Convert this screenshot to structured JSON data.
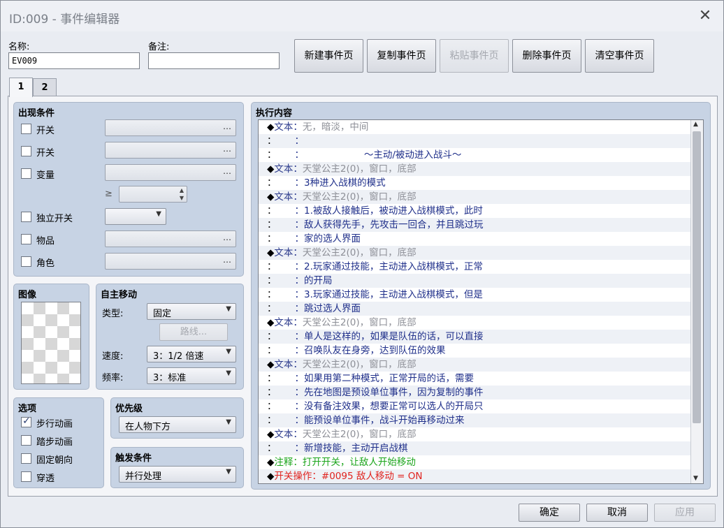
{
  "window": {
    "title": "ID:009 - 事件编辑器",
    "close_icon": "close-icon"
  },
  "fields": {
    "name_label": "名称:",
    "name_value": "EV009",
    "note_label": "备注:",
    "note_value": ""
  },
  "toolbar": {
    "new_page": "新建事件页",
    "copy_page": "复制事件页",
    "paste_page": "粘贴事件页",
    "delete_page": "删除事件页",
    "clear_page": "清空事件页"
  },
  "tabs": [
    "1",
    "2"
  ],
  "conditions": {
    "title": "出现条件",
    "switch1": "开关",
    "switch2": "开关",
    "variable": "变量",
    "gte": "≥",
    "self_switch": "独立开关",
    "item": "物品",
    "actor": "角色",
    "dots": "…"
  },
  "image": {
    "title": "图像"
  },
  "autonomous": {
    "title": "自主移动",
    "type_label": "类型:",
    "type_value": "固定",
    "route_button": "路线...",
    "speed_label": "速度:",
    "speed_value": "3：1/2 倍速",
    "freq_label": "频率:",
    "freq_value": "3：标准"
  },
  "options": {
    "title": "选项",
    "walking": "步行动画",
    "stepping": "踏步动画",
    "direction_fix": "固定朝向",
    "through": "穿透"
  },
  "priority": {
    "title": "优先级",
    "value": "在人物下方"
  },
  "trigger": {
    "title": "触发条件",
    "value": "并行处理"
  },
  "contents": {
    "title": "执行内容",
    "rows": [
      {
        "prefix": "◆",
        "cmd": "文本",
        "sep": "：",
        "text": "无，暗淡，中间",
        "style": "gray"
      },
      {
        "prefix": "：",
        "cmd": "",
        "sep": "：",
        "text": "",
        "style": "body"
      },
      {
        "prefix": "：",
        "cmd": "",
        "sep": "：",
        "text": "                    ～主动/被动进入战斗～",
        "style": "body"
      },
      {
        "prefix": "◆",
        "cmd": "文本",
        "sep": "：",
        "text": "天堂公主2(0)，窗口，底部",
        "style": "gray"
      },
      {
        "prefix": "：",
        "cmd": "",
        "sep": "：",
        "text": "3种进入战棋的模式",
        "style": "body"
      },
      {
        "prefix": "◆",
        "cmd": "文本",
        "sep": "：",
        "text": "天堂公主2(0)，窗口，底部",
        "style": "gray"
      },
      {
        "prefix": "：",
        "cmd": "",
        "sep": "：",
        "text": "1.被敌人接触后，被动进入战棋模式，此时",
        "style": "body"
      },
      {
        "prefix": "：",
        "cmd": "",
        "sep": "：",
        "text": "敌人获得先手，先攻击一回合，并且跳过玩",
        "style": "body"
      },
      {
        "prefix": "：",
        "cmd": "",
        "sep": "：",
        "text": "家的选人界面",
        "style": "body"
      },
      {
        "prefix": "◆",
        "cmd": "文本",
        "sep": "：",
        "text": "天堂公主2(0)，窗口，底部",
        "style": "gray"
      },
      {
        "prefix": "：",
        "cmd": "",
        "sep": "：",
        "text": "2.玩家通过技能，主动进入战棋模式，正常",
        "style": "body"
      },
      {
        "prefix": "：",
        "cmd": "",
        "sep": "：",
        "text": "的开局",
        "style": "body"
      },
      {
        "prefix": "：",
        "cmd": "",
        "sep": "：",
        "text": "3.玩家通过技能，主动进入战棋模式，但是",
        "style": "body"
      },
      {
        "prefix": "：",
        "cmd": "",
        "sep": "：",
        "text": "跳过选人界面",
        "style": "body"
      },
      {
        "prefix": "◆",
        "cmd": "文本",
        "sep": "：",
        "text": "天堂公主2(0)，窗口，底部",
        "style": "gray"
      },
      {
        "prefix": "：",
        "cmd": "",
        "sep": "：",
        "text": "单人是这样的，如果是队伍的话，可以直接",
        "style": "body"
      },
      {
        "prefix": "：",
        "cmd": "",
        "sep": "：",
        "text": "召唤队友在身旁，达到队伍的效果",
        "style": "body"
      },
      {
        "prefix": "◆",
        "cmd": "文本",
        "sep": "：",
        "text": "天堂公主2(0)，窗口，底部",
        "style": "gray"
      },
      {
        "prefix": "：",
        "cmd": "",
        "sep": "：",
        "text": "如果用第二种模式，正常开局的话，需要",
        "style": "body"
      },
      {
        "prefix": "：",
        "cmd": "",
        "sep": "：",
        "text": "先在地图是预设单位事件，因为复制的事件",
        "style": "body"
      },
      {
        "prefix": "：",
        "cmd": "",
        "sep": "：",
        "text": "没有备注效果，想要正常可以选人的开局只",
        "style": "body"
      },
      {
        "prefix": "：",
        "cmd": "",
        "sep": "：",
        "text": "能预设单位事件，战斗开始再移动过来",
        "style": "body"
      },
      {
        "prefix": "◆",
        "cmd": "文本",
        "sep": "：",
        "text": "天堂公主2(0)，窗口，底部",
        "style": "gray"
      },
      {
        "prefix": "：",
        "cmd": "",
        "sep": "：",
        "text": "新增技能，主动开启战棋",
        "style": "body"
      },
      {
        "prefix": "◆",
        "cmd": "注释",
        "sep": "：",
        "text": "打开开关，让敌人开始移动",
        "style": "green"
      },
      {
        "prefix": "◆",
        "cmd": "开关操作",
        "sep": "：",
        "text": "#0095 敌人移动 = ON",
        "style": "red"
      }
    ]
  },
  "footer": {
    "ok": "确定",
    "cancel": "取消",
    "apply": "应用"
  }
}
